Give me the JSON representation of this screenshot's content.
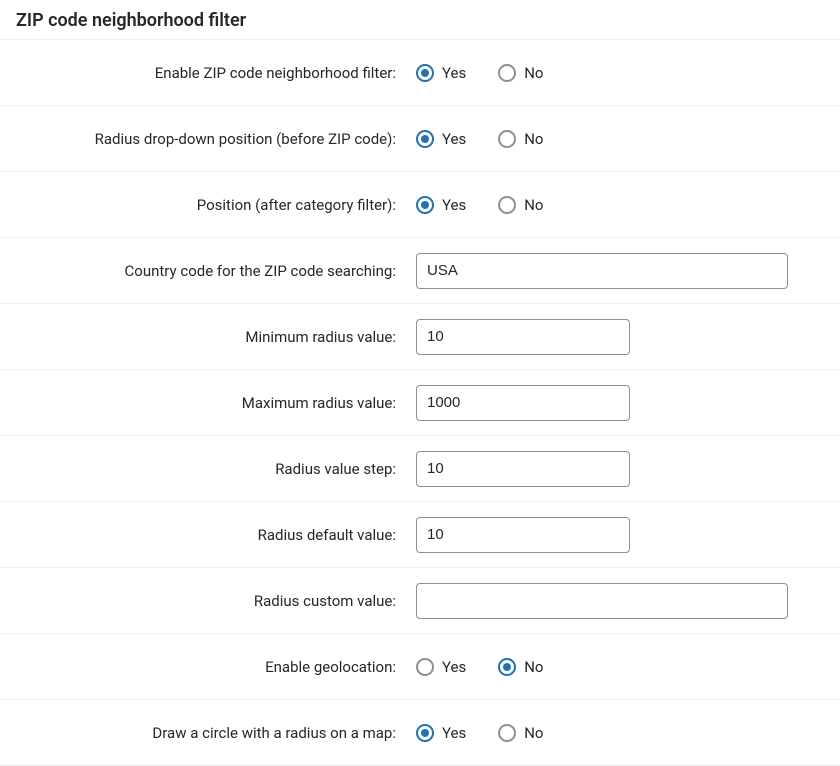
{
  "section": {
    "title": "ZIP code neighborhood filter"
  },
  "labels": {
    "enable": "Enable ZIP code neighborhood filter:",
    "radius_position": "Radius drop-down position (before ZIP code):",
    "position_after_category": "Position (after category filter):",
    "country_code": "Country code for the ZIP code searching:",
    "min_radius": "Minimum radius value:",
    "max_radius": "Maximum radius value:",
    "radius_step": "Radius value step:",
    "radius_default": "Radius default value:",
    "radius_custom": "Radius custom value:",
    "enable_geolocation": "Enable geolocation:",
    "draw_circle": "Draw a circle with a radius on a map:"
  },
  "options": {
    "yes": "Yes",
    "no": "No"
  },
  "values": {
    "enable": "yes",
    "radius_position": "yes",
    "position_after_category": "yes",
    "country_code": "USA",
    "min_radius": "10",
    "max_radius": "1000",
    "radius_step": "10",
    "radius_default": "10",
    "radius_custom": "",
    "enable_geolocation": "no",
    "draw_circle": "yes"
  }
}
